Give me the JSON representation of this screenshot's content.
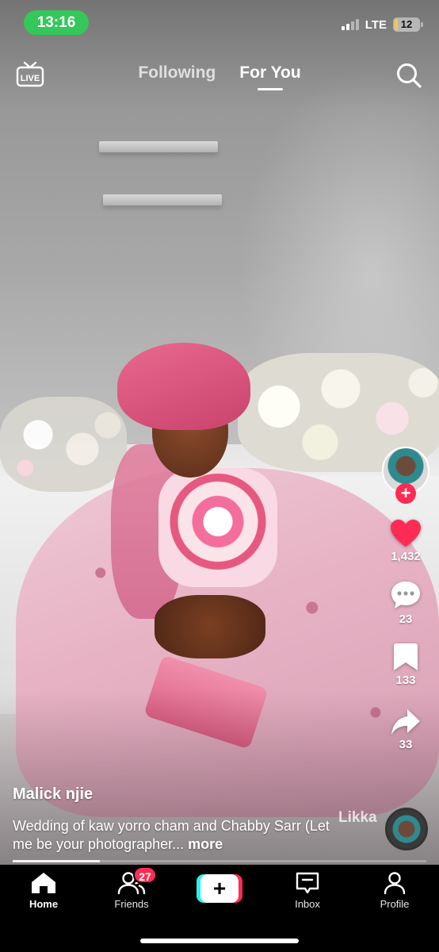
{
  "status_bar": {
    "time": "13:16",
    "network": "LTE",
    "battery": "12",
    "signal_bars": 4,
    "signal_active": 2,
    "battery_level": 0.12,
    "battery_color": "#f5cc3b",
    "time_pill_color": "#34c759"
  },
  "top_nav": {
    "live_icon_text": "LIVE",
    "tabs": [
      {
        "label": "Following",
        "active": false
      },
      {
        "label": "For You",
        "active": true
      }
    ],
    "search_icon": "search-icon"
  },
  "actions": {
    "likes": "1,432",
    "comments": "23",
    "bookmarks": "133",
    "shares": "33",
    "follow_symbol": "+",
    "like_color": "#fe2c55"
  },
  "post": {
    "author": "Malick njie",
    "caption": "Wedding of kaw yorro cham and Chabby Sarr  (Let me  be your photographer...",
    "more_label": "more",
    "sound_label": "Likka",
    "progress": 0.21
  },
  "tabbar": {
    "items": [
      {
        "label": "Home",
        "icon": "home-icon",
        "active": true
      },
      {
        "label": "Friends",
        "icon": "friends-icon",
        "badge": "27"
      },
      {
        "label": "",
        "icon": "create-icon",
        "symbol": "+"
      },
      {
        "label": "Inbox",
        "icon": "inbox-icon"
      },
      {
        "label": "Profile",
        "icon": "profile-icon"
      }
    ]
  }
}
